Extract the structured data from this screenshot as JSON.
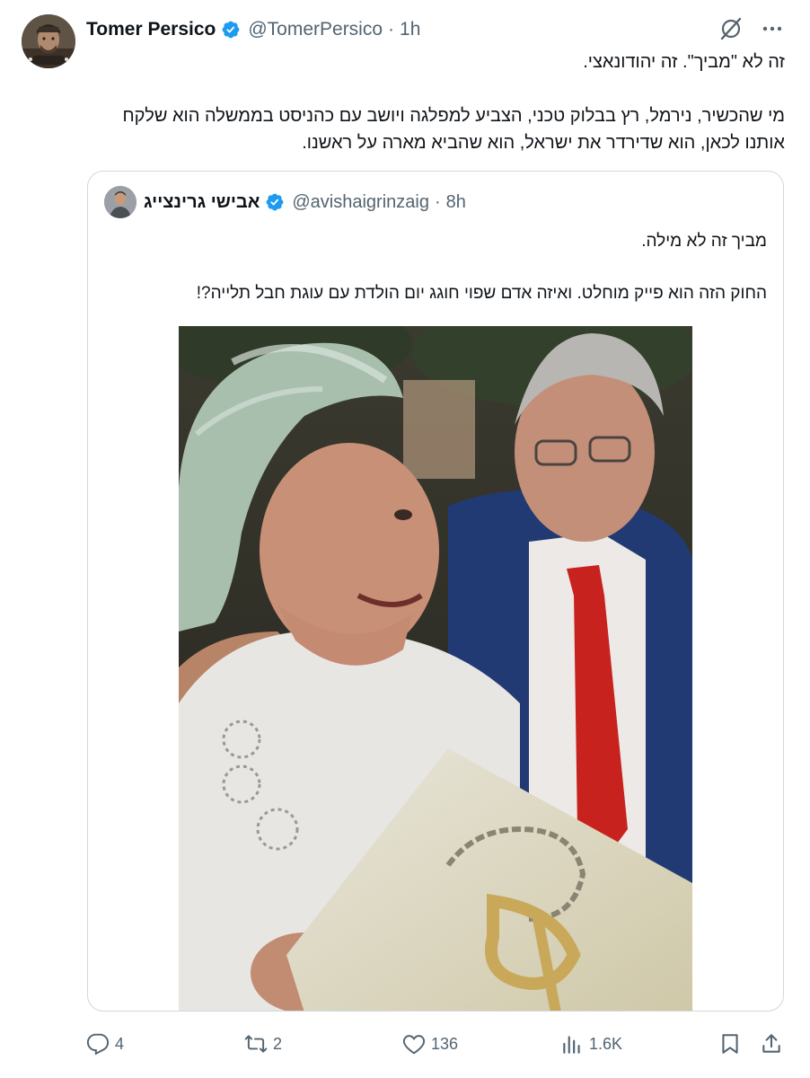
{
  "tweet": {
    "author": {
      "name": "Tomer Persico",
      "handle": "@TomerPersico",
      "separator": "·",
      "time": "1h"
    },
    "text_line1": "זה לא \"מביך\". זה יהודונאצי.",
    "text_para2": "מי שהכשיר, נירמל, רץ בבלוק טכני, הצביע למפלגה ויושב עם כהניסט בממשלה הוא שלקח אותנו לכאן, הוא שדירדר את ישראל, הוא שהביא מארה על ראשנו."
  },
  "quote": {
    "author": {
      "name": "אבישי גרינצייג",
      "handle": "@avishaigrinzaig",
      "separator": "·",
      "time": "8h"
    },
    "text_line1": "מביך זה לא מילה.",
    "text_line2": "החוק הזה הוא פייק מוחלט. ואיזה אדם שפוי חוגג יום הולדת עם עוגת חבל תלייה?!"
  },
  "actions": {
    "replies": "4",
    "reposts": "2",
    "likes": "136",
    "views": "1.6K"
  },
  "colors": {
    "verified": "#1d9bf0",
    "muted": "#536471",
    "border": "#cfd9de",
    "text": "#0f1419"
  }
}
